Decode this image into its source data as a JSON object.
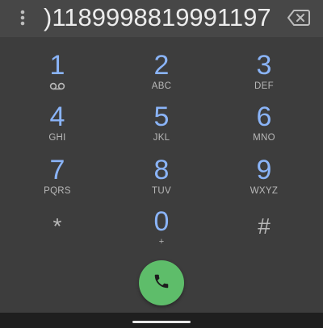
{
  "dialer": {
    "number": ")1189998819991197"
  },
  "keypad": {
    "keys": [
      {
        "digit": "1",
        "letters": ""
      },
      {
        "digit": "2",
        "letters": "ABC"
      },
      {
        "digit": "3",
        "letters": "DEF"
      },
      {
        "digit": "4",
        "letters": "GHI"
      },
      {
        "digit": "5",
        "letters": "JKL"
      },
      {
        "digit": "6",
        "letters": "MNO"
      },
      {
        "digit": "7",
        "letters": "PQRS"
      },
      {
        "digit": "8",
        "letters": "TUV"
      },
      {
        "digit": "9",
        "letters": "WXYZ"
      },
      {
        "digit": "*",
        "letters": ""
      },
      {
        "digit": "0",
        "letters": "+"
      },
      {
        "digit": "#",
        "letters": ""
      }
    ]
  },
  "icons": {
    "menu": "more-vert-icon",
    "backspace": "backspace-icon",
    "voicemail": "voicemail-icon",
    "call": "phone-icon"
  },
  "colors": {
    "background": "#3d3d3d",
    "number_bar": "#474747",
    "digit": "#8ab4f8",
    "call_button": "#5ebd6a",
    "nav_bar": "#1f1f1f"
  }
}
